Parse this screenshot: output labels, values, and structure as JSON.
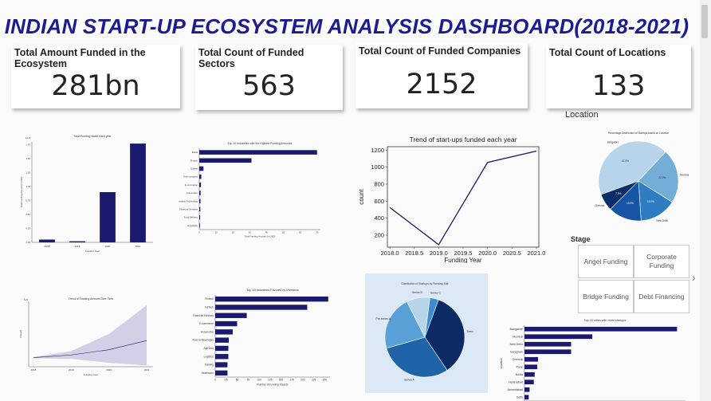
{
  "title": "INDIAN START-UP ECOSYSTEM ANALYSIS DASHBOARD(2018-2021)",
  "kpis": [
    {
      "label": "Total Amount Funded in the Ecosystem",
      "value": "281bn"
    },
    {
      "label": "Total Count of Funded Sectors",
      "value": "563"
    },
    {
      "label": "Total Count of Funded Companies",
      "value": "2152"
    },
    {
      "label": "Total Count of Locations",
      "value": "133"
    }
  ],
  "location_label": "Location",
  "stage": {
    "title": "Stage",
    "options": [
      "Angel Funding",
      "Corporate Funding",
      "Bridge Funding",
      "Debt Financing"
    ]
  },
  "chart_data": [
    {
      "type": "bar",
      "id": "total-funding-each-year",
      "title": "Total Funding Made each year",
      "xlabel": "Funding Year",
      "ylabel": "Total Funding Amount (in USD)",
      "yexp": "1e11",
      "categories": [
        "2018",
        "2019",
        "2020",
        "2021"
      ],
      "values": [
        0.05,
        0.02,
        0.9,
        1.77
      ],
      "ylim": [
        0,
        1.8
      ],
      "yticks": [
        0,
        0.25,
        0.5,
        0.75,
        1.0,
        1.25,
        1.5,
        1.75
      ],
      "color": "#1a1a6e"
    },
    {
      "type": "bar",
      "id": "top-industries-highest-funding",
      "orientation": "horizontal",
      "title": "Top 10 Industries with the Highest Funding Amounts",
      "xlabel": "Total Funding Amount (in USD)",
      "categories": [
        "Retail",
        "Fintech",
        "Edtech",
        "Tech company",
        "E-commerce",
        "Automotive",
        "Information Technology",
        "Financial Services",
        "Food Delivery",
        "Hospitality"
      ],
      "values": [
        70.0,
        31.0,
        2.5,
        1.2,
        1.0,
        0.8,
        0.7,
        0.6,
        0.5,
        0.4
      ],
      "xticks": [
        0,
        10,
        20,
        30,
        40,
        50,
        60,
        70
      ],
      "xlim": [
        0,
        72
      ],
      "color": "#1a1a6e"
    },
    {
      "type": "line",
      "id": "trend-startups-funded",
      "title": "Trend of start-ups funded each year",
      "xlabel": "Funding Year",
      "ylabel": "count",
      "x": [
        2018,
        2019,
        2020,
        2021
      ],
      "y": [
        526,
        89,
        1055,
        1189
      ],
      "xticks": [
        "2018.0",
        "2018.5",
        "2019.0",
        "2019.5",
        "2020.0",
        "2020.5",
        "2021.0"
      ],
      "yticks": [
        200,
        400,
        600,
        800,
        1000,
        1200
      ],
      "xlim": [
        2017.95,
        2021.05
      ],
      "ylim": [
        60,
        1240
      ],
      "color": "#1a1a6e"
    },
    {
      "type": "pie",
      "id": "distribution-by-location",
      "title": "Percentage Distribution of Startups based on Location",
      "labels": [
        "Bangalore",
        "Mumbai",
        "New Delhi",
        "Gurugram",
        "Chennai"
      ],
      "values": [
        42.5,
        22.0,
        15.0,
        13.5,
        7.0
      ],
      "slice_labels": [
        "42.5%",
        "22.0%",
        "15.0%",
        "13.5%",
        "7.0%"
      ],
      "colors": [
        "#b8d4ea",
        "#74aed8",
        "#2f7cc0",
        "#1655a3",
        "#0c2f6b"
      ]
    },
    {
      "type": "area",
      "id": "funding-amount-over-time",
      "title": "Trend of Funding Amount Over Time",
      "xlabel": "Funding Year",
      "ylabel": "Amount",
      "yexp": "1e9",
      "x": [
        2018,
        2019,
        2020,
        2021
      ],
      "y": [
        0.2,
        0.4,
        0.8,
        1.5
      ],
      "upper": [
        0.25,
        0.7,
        2.0,
        4.2
      ],
      "lower": [
        0.15,
        0.1,
        -0.2,
        -0.4
      ],
      "xticks": [
        "2018",
        "2019",
        "2020",
        "2021"
      ],
      "ylim": [
        -0.5,
        4.5
      ],
      "color": "#1a1a6e",
      "band_color": "#c9c8e2"
    },
    {
      "type": "bar",
      "id": "top-industries-by-investors",
      "orientation": "horizontal",
      "title": "Top 10 Industries Favored by Investors",
      "xlabel": "Number of Funding Rounds",
      "categories": [
        "Fintech",
        "EdTech",
        "Financial Services",
        "E-commerce",
        "Automotive",
        "Food & Beverages",
        "AgriTech",
        "Logistics",
        "Gaming",
        "Healthcare"
      ],
      "values": [
        258,
        210,
        72,
        50,
        40,
        31,
        30,
        30,
        28,
        28
      ],
      "xticks": [
        0,
        25,
        50,
        75,
        100,
        125,
        150,
        175,
        200,
        225,
        250
      ],
      "xlim": [
        0,
        262
      ],
      "color": "#1a1a6e"
    },
    {
      "type": "pie",
      "id": "distribution-by-funding-stat",
      "title": "Distribution of Startups by Funding Stat",
      "labels": [
        "Seed",
        "Series A",
        "Pre-series A",
        "Series B",
        "Series C"
      ],
      "values": [
        35.0,
        30.0,
        22.0,
        9.5,
        3.5
      ],
      "colors": [
        "#0c2a63",
        "#1f63a8",
        "#58a0d6",
        "#b8d4ea",
        "#3d8bd0"
      ]
    },
    {
      "type": "bar",
      "id": "top-cities-most-startups",
      "orientation": "horizontal",
      "title": "Top 10 cities with most startups",
      "ylabel": "Location",
      "categories": [
        "Bangalore",
        "Mumbai",
        "New Delhi",
        "Gurugram",
        "Chennai",
        "Pune",
        "Noida",
        "Hyderabad",
        "Ahmedabad",
        "Delhi"
      ],
      "values": [
        900,
        400,
        275,
        275,
        80,
        75,
        60,
        55,
        30,
        25
      ],
      "xlim": [
        0,
        950
      ],
      "color": "#1a1a6e"
    }
  ]
}
